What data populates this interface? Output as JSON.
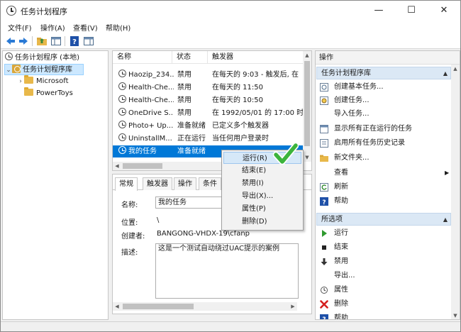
{
  "window": {
    "title": "任务计划程序",
    "minimize": "—",
    "maximize": "☐",
    "close": "✕"
  },
  "menu": [
    "文件(F)",
    "操作(A)",
    "查看(V)",
    "帮助(H)"
  ],
  "tree": {
    "root": "任务计划程序 (本地)",
    "library": "任务计划程序库",
    "children": [
      "Microsoft",
      "PowerToys"
    ]
  },
  "task_list": {
    "columns": [
      "名称",
      "状态",
      "触发器"
    ],
    "rows": [
      {
        "name": "Haozip_234...",
        "status": "禁用",
        "trigger": "在每天的 9:03 - 触发后, 在"
      },
      {
        "name": "Health-Che...",
        "status": "禁用",
        "trigger": "在每天的 11:50"
      },
      {
        "name": "Health-Che...",
        "status": "禁用",
        "trigger": "在每天的 10:50"
      },
      {
        "name": "OneDrive S...",
        "status": "禁用",
        "trigger": "在 1992/05/01 的 17:00 时"
      },
      {
        "name": "Photo+ Up...",
        "status": "准备就绪",
        "trigger": "已定义多个触发器"
      },
      {
        "name": "UninstallM...",
        "status": "正在运行",
        "trigger": "当任何用户登录时"
      },
      {
        "name": "我的任务",
        "status": "准备就绪",
        "trigger": ""
      }
    ]
  },
  "context_menu": [
    "运行(R)",
    "结束(E)",
    "禁用(I)",
    "导出(X)...",
    "属性(P)",
    "删除(D)"
  ],
  "details": {
    "tabs": [
      "常规",
      "触发器",
      "操作",
      "条件"
    ],
    "name_label": "名称:",
    "name_value": "我的任务",
    "location_label": "位置:",
    "location_value": "\\",
    "author_label": "创建者:",
    "author_value": "BANGONG-VHDX-19\\cfanp",
    "description_label": "描述:",
    "description_value": "这是一个测试自动绕过UAC提示的案例"
  },
  "actions": {
    "title": "操作",
    "section1": "任务计划程序库",
    "items1": [
      {
        "label": "创建基本任务...",
        "icon": "create-basic-task-icon"
      },
      {
        "label": "创建任务...",
        "icon": "create-task-icon"
      },
      {
        "label": "导入任务...",
        "icon": "none"
      },
      {
        "label": "显示所有正在运行的任务",
        "icon": "running-tasks-icon"
      },
      {
        "label": "启用所有任务历史记录",
        "icon": "history-icon"
      },
      {
        "label": "新文件夹...",
        "icon": "new-folder-icon"
      },
      {
        "label": "查看",
        "icon": "none"
      },
      {
        "label": "刷新",
        "icon": "refresh-icon"
      },
      {
        "label": "帮助",
        "icon": "help-icon"
      }
    ],
    "section2": "所选项",
    "items2": [
      {
        "label": "运行",
        "icon": "run-icon"
      },
      {
        "label": "结束",
        "icon": "end-icon"
      },
      {
        "label": "禁用",
        "icon": "disable-icon"
      },
      {
        "label": "导出...",
        "icon": "none"
      },
      {
        "label": "属性",
        "icon": "properties-icon"
      },
      {
        "label": "删除",
        "icon": "delete-icon"
      },
      {
        "label": "帮助",
        "icon": "help-icon"
      }
    ]
  },
  "colors": {
    "selection": "#0078d7",
    "section_bg": "#dbe8f5",
    "checkmark": "#3cb43c"
  }
}
